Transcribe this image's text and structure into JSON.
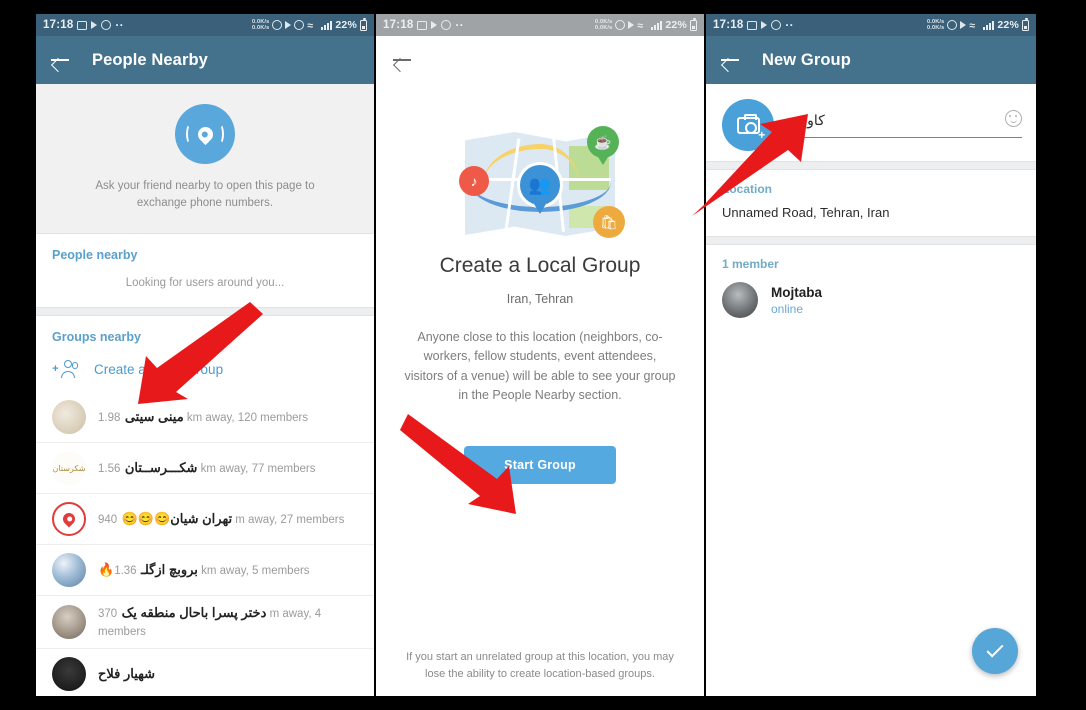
{
  "meta": {
    "app": "Telegram",
    "accent_blue": "#4aa0d8",
    "appbar_blue": "#44718c",
    "arrow_red": "#e8191b",
    "link_blue": "#5ba0cc"
  },
  "status_bar": {
    "time": "17:18",
    "net_up": "0.0K/s",
    "net_down": "0.0K/s",
    "battery": "22%",
    "icons": [
      "gallery-icon",
      "play-icon",
      "screenshot-icon",
      "more-dots-icon",
      "alarm-icon",
      "mute-icon",
      "location-icon",
      "wifi-icon",
      "signal-icon",
      "battery-icon"
    ]
  },
  "panel1": {
    "appbar": {
      "title": "People Nearby",
      "back_icon": "back-arrow-icon"
    },
    "hero": {
      "icon": "location-broadcast-icon",
      "text": "Ask your friend nearby to open this page to exchange phone numbers."
    },
    "people_section": {
      "heading": "People nearby",
      "status": "Looking for users around you..."
    },
    "groups_section": {
      "heading": "Groups nearby",
      "create_label": "Create a Local Group",
      "create_icon": "add-users-icon",
      "items": [
        {
          "name": "مینی سیتی",
          "sub": "1.98 km away, 120 members",
          "avatar": "av-a"
        },
        {
          "name": "شکـــرســتان",
          "sub": "1.56 km away, 77 members",
          "avatar": "av-b",
          "avatar_text": "شکرستان"
        },
        {
          "name": "تهران شیان😊😊😊",
          "sub": "940 m away, 27 members",
          "avatar": "av-c"
        },
        {
          "name": "🔥بروبچ ازگلـ",
          "sub": "1.36 km away, 5 members",
          "avatar": "av-d"
        },
        {
          "name": "دختر پسرا باحال منطقه یک",
          "sub": "370 m away, 4 members",
          "avatar": "av-e"
        },
        {
          "name": "شهیار فلاح",
          "sub": "",
          "avatar": "av-f"
        }
      ]
    }
  },
  "panel2": {
    "back_icon": "back-arrow-icon",
    "map_illustration": {
      "pins": [
        "music-pin-icon",
        "people-pin-icon",
        "coffee-pin-icon",
        "shop-pin-icon"
      ]
    },
    "title": "Create a Local Group",
    "place": "Iran, Tehran",
    "description": "Anyone close to this location (neighbors, co-workers, fellow students, event attendees, visitors of a venue) will be able to see your group in the People Nearby section.",
    "start_button": "Start Group",
    "footer": "If you start an unrelated group at this location, you may lose the ability to create location-based groups."
  },
  "panel3": {
    "appbar": {
      "title": "New Group",
      "back_icon": "back-arrow-icon"
    },
    "photo_button_icon": "camera-add-icon",
    "group_name_value": "کاوش",
    "emoji_icon": "emoji-smile-icon",
    "location_label": "Location",
    "location_value": "Unnamed Road, Tehran, Iran",
    "members_label": "1 member",
    "members": [
      {
        "name": "Mojtaba",
        "status": "online"
      }
    ],
    "confirm_fab_icon": "check-icon"
  },
  "annotations": {
    "arrows": [
      {
        "name": "arrow-to-create-local-group",
        "direction": "down-left"
      },
      {
        "name": "arrow-to-start-group-button",
        "direction": "down-right"
      },
      {
        "name": "arrow-to-group-photo-button",
        "direction": "up-right"
      }
    ]
  }
}
